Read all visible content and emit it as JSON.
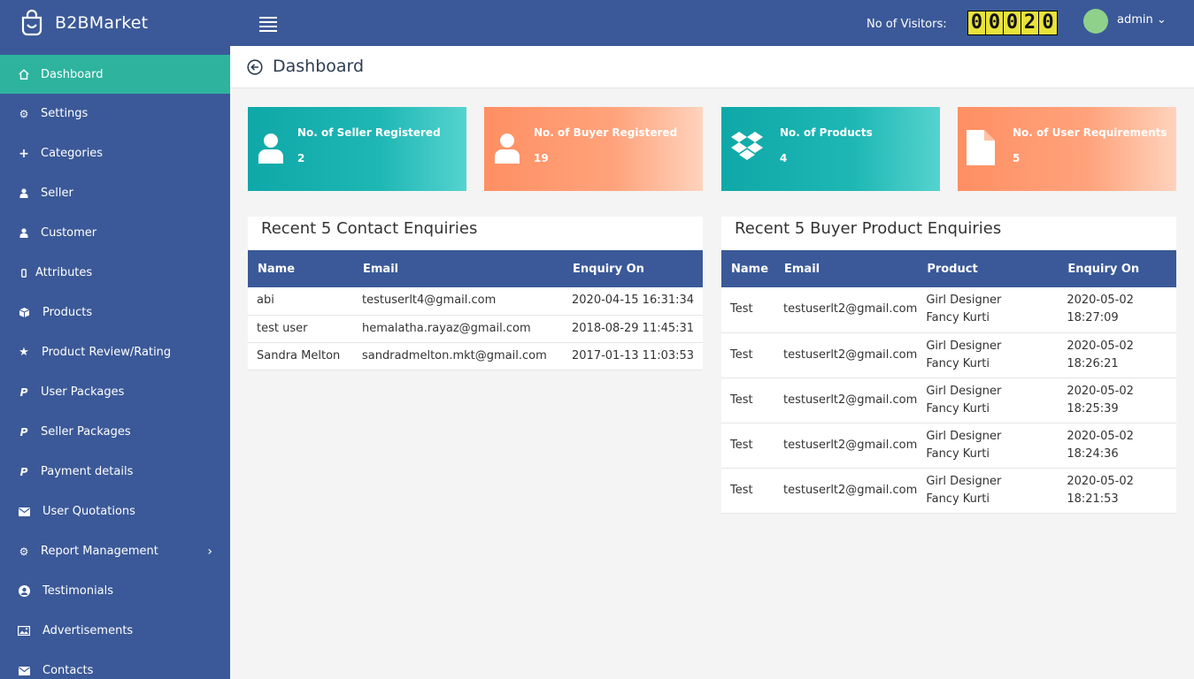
{
  "header": {
    "brand": "B2BMarket",
    "visitors_label": "No of Visitors:",
    "visitor_digits": [
      "0",
      "0",
      "0",
      "2",
      "0"
    ],
    "user": "admin ⌄"
  },
  "sidebar": {
    "items": [
      {
        "label": "Dashboard",
        "icon": "home-icon"
      },
      {
        "label": "Settings",
        "icon": "gear-icon"
      },
      {
        "label": "Categories",
        "icon": "plus-icon"
      },
      {
        "label": "Seller",
        "icon": "user-icon"
      },
      {
        "label": "Customer",
        "icon": "user-icon"
      },
      {
        "label": "Attributes",
        "icon": "mobile-icon"
      },
      {
        "label": "Products",
        "icon": "cube-icon"
      },
      {
        "label": "Product Review/Rating",
        "icon": "star-icon"
      },
      {
        "label": "User Packages",
        "icon": "paypal-icon"
      },
      {
        "label": "Seller Packages",
        "icon": "paypal-icon"
      },
      {
        "label": "Payment details",
        "icon": "paypal-icon"
      },
      {
        "label": "User Quotations",
        "icon": "envelope-icon"
      },
      {
        "label": "Report Management",
        "icon": "gear-icon"
      },
      {
        "label": "Testimonials",
        "icon": "user-circle-icon"
      },
      {
        "label": "Advertisements",
        "icon": "image-icon"
      },
      {
        "label": "Contacts",
        "icon": "envelope-icon"
      }
    ]
  },
  "page": {
    "title": "Dashboard"
  },
  "stats": [
    {
      "label": "No. of Seller Registered",
      "value": "2",
      "icon": "user-icon",
      "color": "#1eb7b4"
    },
    {
      "label": "No. of Buyer Registered",
      "value": "19",
      "icon": "user-icon",
      "color": "#ffa37c"
    },
    {
      "label": "No. of Products",
      "value": "4",
      "icon": "dropbox-icon",
      "color": "#1eb7b4"
    },
    {
      "label": "No. of User Requirements",
      "value": "5",
      "icon": "file-icon",
      "color": "#ffa37c"
    }
  ],
  "contact_enquiries": {
    "title": "Recent 5 Contact Enquiries",
    "columns": [
      "Name",
      "Email",
      "Enquiry On"
    ],
    "rows": [
      [
        "abi",
        "testuserlt4@gmail.com",
        "2020-04-15 16:31:34"
      ],
      [
        "test user",
        "hemalatha.rayaz@gmail.com",
        "2018-08-29 11:45:31"
      ],
      [
        "Sandra Melton",
        "sandradmelton.mkt@gmail.com",
        "2017-01-13 11:03:53"
      ]
    ]
  },
  "product_enquiries": {
    "title": "Recent 5 Buyer Product Enquiries",
    "columns": [
      "Name",
      "Email",
      "Product",
      "Enquiry On"
    ],
    "rows": [
      [
        "Test",
        "testuserlt2@gmail.com",
        "Girl Designer Fancy Kurti",
        "2020-05-02 18:27:09"
      ],
      [
        "Test",
        "testuserlt2@gmail.com",
        "Girl Designer Fancy Kurti",
        "2020-05-02 18:26:21"
      ],
      [
        "Test",
        "testuserlt2@gmail.com",
        "Girl Designer Fancy Kurti",
        "2020-05-02 18:25:39"
      ],
      [
        "Test",
        "testuserlt2@gmail.com",
        "Girl Designer Fancy Kurti",
        "2020-05-02 18:24:36"
      ],
      [
        "Test",
        "testuserlt2@gmail.com",
        "Girl Designer Fancy Kurti",
        "2020-05-02 18:21:53"
      ]
    ]
  },
  "colors": {
    "primary": "#3b5998",
    "active": "#2db39e",
    "teal": "#1eb7b4",
    "orange": "#ffa37c"
  }
}
